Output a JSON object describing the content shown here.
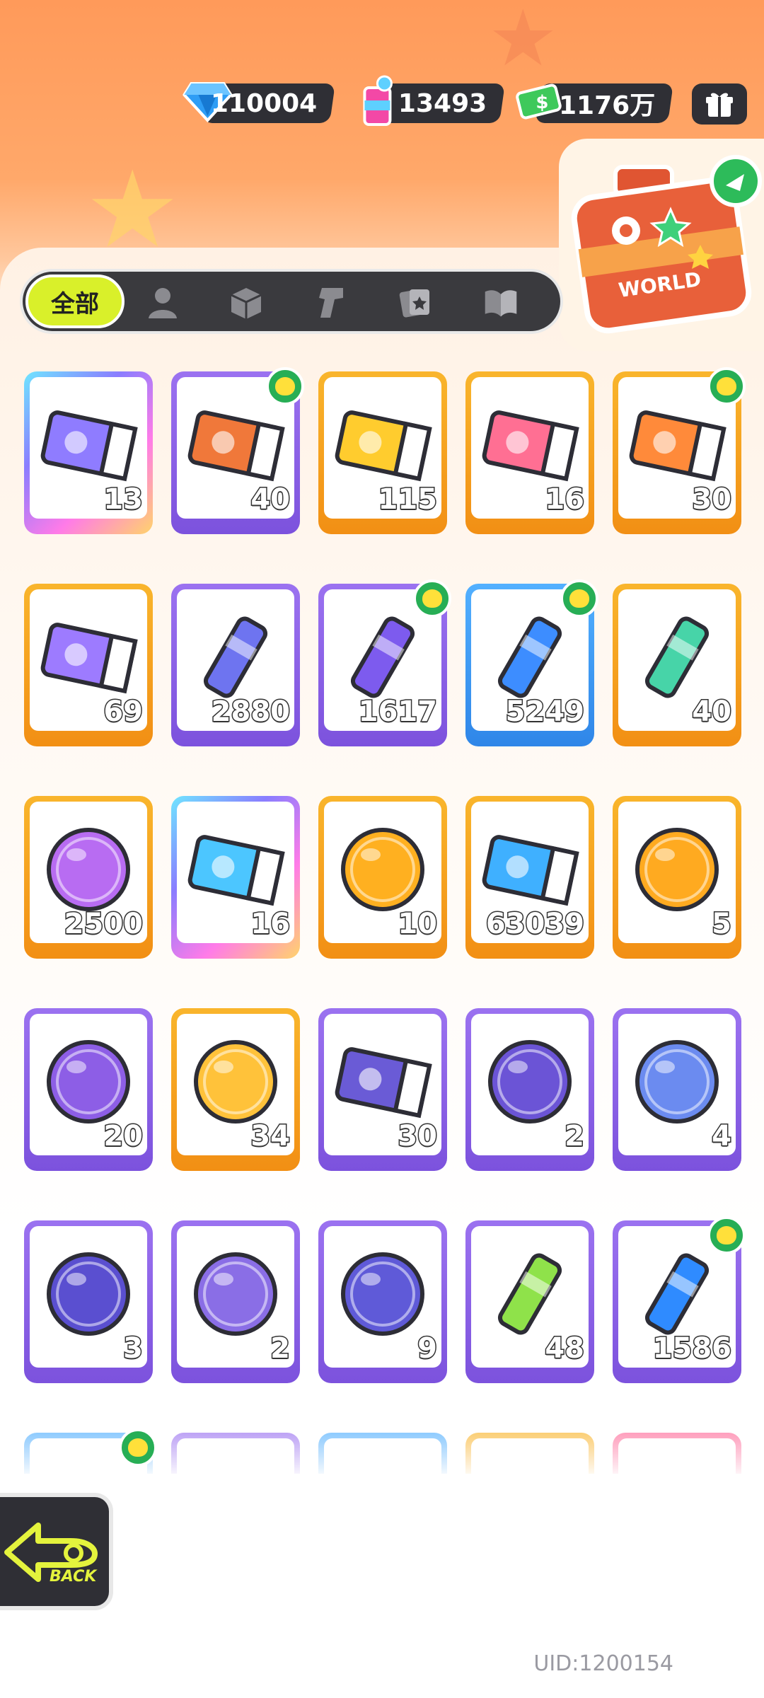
{
  "currencies": [
    {
      "name": "diamond-icon",
      "value": "110004"
    },
    {
      "name": "paint-can-icon",
      "value": "13493"
    },
    {
      "name": "cash-icon",
      "value": "1176万"
    }
  ],
  "filter": {
    "all_label": "全部",
    "tabs": [
      "person-icon",
      "box-icon",
      "pistol-icon",
      "cards-icon",
      "book-icon"
    ]
  },
  "promo": {
    "label": "WORLD"
  },
  "items": [
    {
      "qty": "13",
      "frame": "rainbow",
      "badge": false,
      "art": "purple-ticket"
    },
    {
      "qty": "40",
      "frame": "purple",
      "badge": true,
      "art": "lion-ticket"
    },
    {
      "qty": "115",
      "frame": "orange",
      "badge": false,
      "art": "yellow-ticket"
    },
    {
      "qty": "16",
      "frame": "orange",
      "badge": false,
      "art": "character-ticket"
    },
    {
      "qty": "30",
      "frame": "orange",
      "badge": true,
      "art": "fruit-ticket"
    },
    {
      "qty": "69",
      "frame": "orange",
      "badge": false,
      "art": "violet-ticket"
    },
    {
      "qty": "2880",
      "frame": "purple",
      "badge": false,
      "art": "star-crystal"
    },
    {
      "qty": "1617",
      "frame": "purple",
      "badge": true,
      "art": "purple-crayon"
    },
    {
      "qty": "5249",
      "frame": "blue",
      "badge": true,
      "art": "blue-crayon"
    },
    {
      "qty": "40",
      "frame": "orange",
      "badge": false,
      "art": "color-cube"
    },
    {
      "qty": "2500",
      "frame": "orange",
      "badge": false,
      "art": "cool-sticker"
    },
    {
      "qty": "16",
      "frame": "rainbow",
      "badge": false,
      "art": "lottery-ticket"
    },
    {
      "qty": "10",
      "frame": "orange",
      "badge": false,
      "art": "star-badge"
    },
    {
      "qty": "63039",
      "frame": "orange",
      "badge": false,
      "art": "season-ticket"
    },
    {
      "qty": "5",
      "frame": "orange",
      "badge": false,
      "art": "mystery-egg-orange"
    },
    {
      "qty": "20",
      "frame": "purple",
      "badge": false,
      "art": "mystery-egg-purple"
    },
    {
      "qty": "34",
      "frame": "orange",
      "badge": false,
      "art": "mystery-badge"
    },
    {
      "qty": "30",
      "frame": "purple",
      "badge": false,
      "art": "travel-card"
    },
    {
      "qty": "2",
      "frame": "purple",
      "badge": false,
      "art": "cat-orb"
    },
    {
      "qty": "4",
      "frame": "purple",
      "badge": false,
      "art": "fish-orb"
    },
    {
      "qty": "3",
      "frame": "purple",
      "badge": false,
      "art": "piranha-orb"
    },
    {
      "qty": "2",
      "frame": "purple",
      "badge": false,
      "art": "yellow-orb"
    },
    {
      "qty": "9",
      "frame": "purple",
      "badge": false,
      "art": "plant-orb"
    },
    {
      "qty": "48",
      "frame": "purple",
      "badge": false,
      "art": "green-cup"
    },
    {
      "qty": "1586",
      "frame": "purple",
      "badge": true,
      "art": "spray-can"
    },
    {
      "qty": "",
      "frame": "blue",
      "badge": true,
      "art": "partial"
    },
    {
      "qty": "",
      "frame": "purple",
      "badge": false,
      "art": "partial"
    },
    {
      "qty": "",
      "frame": "blue",
      "badge": false,
      "art": "partial"
    },
    {
      "qty": "",
      "frame": "orange",
      "badge": false,
      "art": "partial"
    },
    {
      "qty": "",
      "frame": "pink",
      "badge": false,
      "art": "partial"
    }
  ],
  "back": {
    "label": "BACK"
  },
  "uid": "UID:1200154",
  "colors": {
    "orange": "#f7a21b",
    "purple": "#8e63e8",
    "blue": "#3fa0f5",
    "pink": "#f5568a",
    "accent": "#d9f02a"
  }
}
